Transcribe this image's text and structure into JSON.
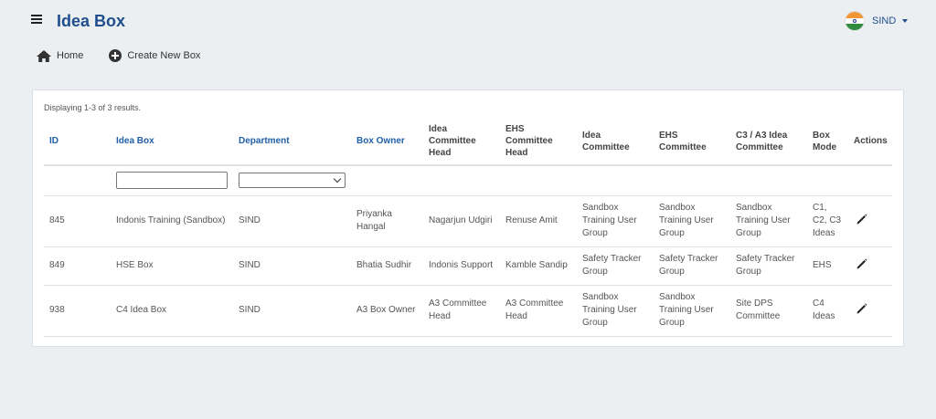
{
  "header": {
    "title": "Idea Box",
    "menu_icon": "hamburger-icon",
    "user": {
      "name": "SIND",
      "flag_icon": "india-flag-icon"
    }
  },
  "nav": {
    "home_label": "Home",
    "create_label": "Create New Box"
  },
  "grid": {
    "summary": "Displaying 1-3 of 3 results.",
    "columns": {
      "id": "ID",
      "idea_box": "Idea Box",
      "department": "Department",
      "box_owner": "Box Owner",
      "idea_committee_head": "Idea Committee Head",
      "ehs_committee_head": "EHS Committee Head",
      "idea_committee": "Idea Committee",
      "ehs_committee": "EHS Committee",
      "c3a3_committee": "C3 / A3 Idea Committee",
      "box_mode": "Box Mode",
      "actions": "Actions"
    },
    "filters": {
      "idea_box_value": "",
      "department_value": ""
    },
    "rows": [
      {
        "id": "845",
        "idea_box": "Indonis Training (Sandbox)",
        "department": "SIND",
        "box_owner": "Priyanka Hangal",
        "idea_committee_head": "Nagarjun Udgiri",
        "ehs_committee_head": "Renuse Amit",
        "idea_committee": "Sandbox Training User Group",
        "ehs_committee": "Sandbox Training User Group",
        "c3a3_committee": "Sandbox Training User Group",
        "box_mode": "C1, C2, C3 Ideas"
      },
      {
        "id": "849",
        "idea_box": "HSE Box",
        "department": "SIND",
        "box_owner": "Bhatia Sudhir",
        "idea_committee_head": "Indonis Support",
        "ehs_committee_head": "Kamble Sandip",
        "idea_committee": "Safety Tracker Group",
        "ehs_committee": "Safety Tracker Group",
        "c3a3_committee": "Safety Tracker Group",
        "box_mode": "EHS"
      },
      {
        "id": "938",
        "idea_box": "C4 Idea Box",
        "department": "SIND",
        "box_owner": "A3 Box Owner",
        "idea_committee_head": "A3 Committee Head",
        "ehs_committee_head": "A3 Committee Head",
        "idea_committee": "Sandbox Training User Group",
        "ehs_committee": "Sandbox Training User Group",
        "c3a3_committee": "Site DPS Committee",
        "box_mode": "C4 Ideas"
      }
    ],
    "action_icon": "pencil-edit-icon"
  },
  "colors": {
    "accent": "#1f4e8c",
    "link": "#1f5fa8",
    "background": "#eceff1"
  }
}
